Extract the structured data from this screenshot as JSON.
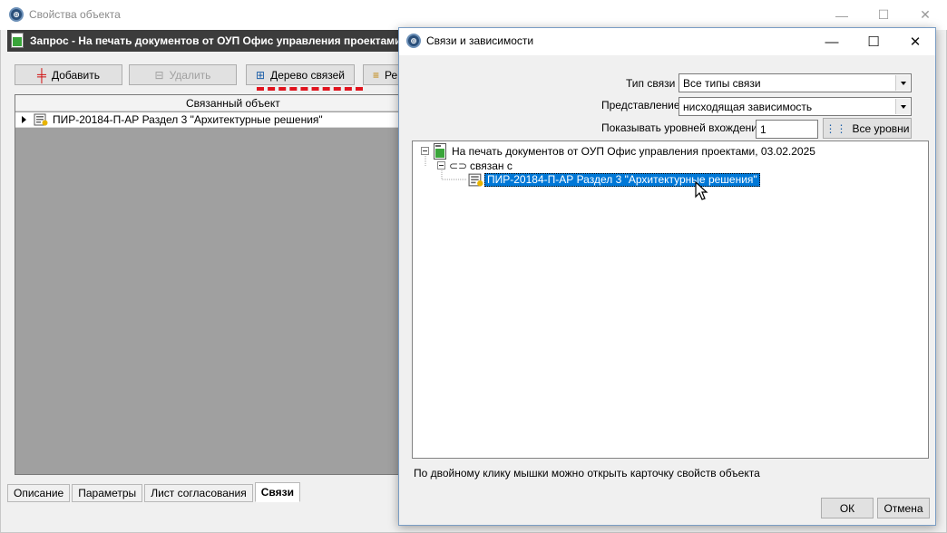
{
  "background_window": {
    "title": "Свойства объекта",
    "header": "Запрос - На печать документов от ОУП Офис управления проектами, С",
    "toolbar": {
      "add_label": "Добавить",
      "delete_label": "Удалить",
      "tree_label": "Дерево связей",
      "edit_label": "Ре"
    },
    "grid": {
      "column_header": "Связанный объект",
      "rows": [
        "ПИР-20184-П-АР Раздел 3 \"Архитектурные решения\""
      ]
    },
    "tabs": [
      "Описание",
      "Параметры",
      "Лист согласования",
      "Связи"
    ],
    "active_tab": "Связи"
  },
  "dialog": {
    "title": "Связи и зависимости",
    "link_type": {
      "label": "Тип связи",
      "value": "Все типы связи"
    },
    "view": {
      "label": "Представление",
      "value": "нисходящая зависимость"
    },
    "levels": {
      "label": "Показывать уровней вхождения",
      "value": "1",
      "all_levels_label": "Все уровни"
    },
    "tree": {
      "root": "На печать документов от ОУП Офис управления проектами, 03.02.2025",
      "relation": "связан с",
      "child": "ПИР-20184-П-АР Раздел 3 \"Архитектурные решения\""
    },
    "hint": "По двойному клику мышки можно открыть карточку свойств объекта",
    "ok_label": "ОК",
    "cancel_label": "Отмена"
  },
  "colors": {
    "selection": "#0078d7",
    "dash_highlight": "#e0141e",
    "header_bar": "#3c3c3c"
  }
}
